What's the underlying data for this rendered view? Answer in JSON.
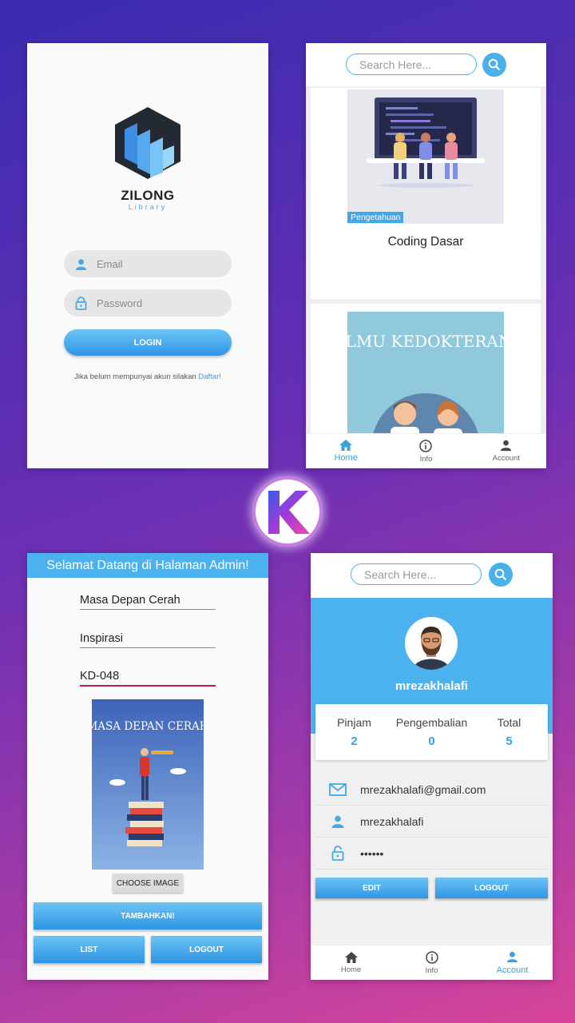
{
  "colors": {
    "accent": "#4cb2ee",
    "focus_underline": "#c2185b",
    "background_start": "#3a2cb0",
    "background_end": "#d8459a"
  },
  "login": {
    "logo_title": "ZILONG",
    "logo_subtitle": "Library",
    "email_placeholder": "Email",
    "password_placeholder": "Password",
    "login_button": "LOGIN",
    "signup_text": "Jika belum mempunyai akun silakan",
    "signup_link": "Daftar!"
  },
  "home": {
    "search_placeholder": "Search Here...",
    "books": [
      {
        "category": "Pengetahuan",
        "title": "Coding Dasar"
      },
      {
        "cover_text": "ILMU KEDOKTERAN"
      }
    ],
    "nav": [
      {
        "label": "Home",
        "icon": "home-icon",
        "active": true
      },
      {
        "label": "Info",
        "icon": "info-icon",
        "active": false
      },
      {
        "label": "Account",
        "icon": "account-icon",
        "active": false
      }
    ]
  },
  "admin": {
    "header": "Selamat Datang di Halaman Admin!",
    "title_value": "Masa Depan Cerah",
    "category_value": "Inspirasi",
    "code_value": "KD-048",
    "cover_text": "MASA DEPAN CERAH",
    "choose_image_button": "CHOOSE IMAGE",
    "add_button": "TAMBAHKAN!",
    "list_button": "LIST",
    "logout_button": "LOGOUT"
  },
  "account": {
    "search_placeholder": "Search Here...",
    "username": "mrezakhalafi",
    "stats": [
      {
        "label": "Pinjam",
        "value": "2"
      },
      {
        "label": "Pengembalian",
        "value": "0"
      },
      {
        "label": "Total",
        "value": "5"
      }
    ],
    "email": "mrezakhalafi@gmail.com",
    "user": "mrezakhalafi",
    "password_mask": "••••••",
    "edit_button": "EDIT",
    "logout_button": "LOGOUT",
    "nav": [
      {
        "label": "Home",
        "icon": "home-icon",
        "active": false
      },
      {
        "label": "Info",
        "icon": "info-icon",
        "active": false
      },
      {
        "label": "Account",
        "icon": "account-icon",
        "active": true
      }
    ]
  }
}
